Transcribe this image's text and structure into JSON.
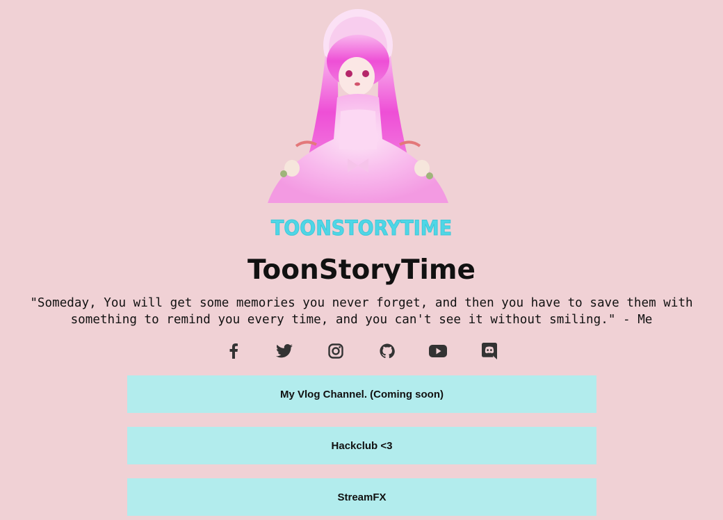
{
  "profile": {
    "avatar_icon": "avatar-image",
    "logo_text": "TOONSTORYTIME",
    "name": "ToonStoryTime",
    "quote": "\"Someday, You will get some memories you never forget, and then you have to save them with something to remind you every time, and you can't see it without smiling.\" - Me"
  },
  "socials": [
    {
      "icon": "facebook-icon"
    },
    {
      "icon": "twitter-icon"
    },
    {
      "icon": "instagram-icon"
    },
    {
      "icon": "github-icon"
    },
    {
      "icon": "youtube-icon"
    },
    {
      "icon": "discord-icon"
    }
  ],
  "links": [
    {
      "label": "My Vlog Channel. (Coming soon)"
    },
    {
      "label": "Hackclub <3"
    },
    {
      "label": "StreamFX"
    }
  ],
  "colors": {
    "background": "#f0d1d5",
    "button": "#b2eced",
    "logo": "#4fd6e6",
    "text": "#111111"
  }
}
